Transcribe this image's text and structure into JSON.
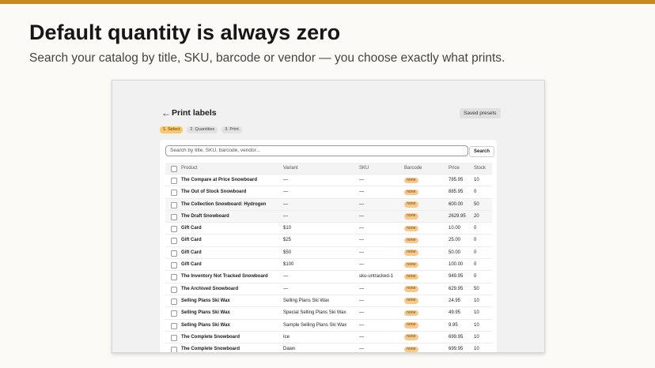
{
  "headline": "Default quantity is always zero",
  "subline": "Search your catalog by title, SKU, barcode or vendor — you choose exactly what prints.",
  "app": {
    "back_icon": "←",
    "title": "Print labels",
    "saved_presets": "Saved presets",
    "steps": [
      "1. Select",
      "2. Quantities",
      "3. Print"
    ],
    "search": {
      "placeholder": "Search by title, SKU, barcode, vendor...",
      "button": "Search"
    },
    "columns": [
      "Product",
      "Variant",
      "SKU",
      "Barcode",
      "Price",
      "Stock"
    ],
    "rows": [
      {
        "product": "The Compare at Price Snowboard",
        "variant": "—",
        "sku": "—",
        "barcode": "none",
        "price": "785.95",
        "stock": "10"
      },
      {
        "product": "The Out of Stock Snowboard",
        "variant": "—",
        "sku": "—",
        "barcode": "none",
        "price": "885.95",
        "stock": "0"
      },
      {
        "product": "The Collection Snowboard: Hydrogen",
        "variant": "—",
        "sku": "—",
        "barcode": "none",
        "price": "600.00",
        "stock": "50"
      },
      {
        "product": "The Draft Snowboard",
        "variant": "—",
        "sku": "—",
        "barcode": "none",
        "price": "2629.95",
        "stock": "20"
      },
      {
        "product": "Gift Card",
        "variant": "$10",
        "sku": "—",
        "barcode": "none",
        "price": "10.00",
        "stock": "0"
      },
      {
        "product": "Gift Card",
        "variant": "$25",
        "sku": "—",
        "barcode": "none",
        "price": "25.00",
        "stock": "0"
      },
      {
        "product": "Gift Card",
        "variant": "$50",
        "sku": "—",
        "barcode": "none",
        "price": "50.00",
        "stock": "0"
      },
      {
        "product": "Gift Card",
        "variant": "$100",
        "sku": "—",
        "barcode": "none",
        "price": "100.00",
        "stock": "0"
      },
      {
        "product": "The Inventory Not Tracked Snowboard",
        "variant": "—",
        "sku": "sku-untracked-1",
        "barcode": "none",
        "price": "949.95",
        "stock": "0"
      },
      {
        "product": "The Archived Snowboard",
        "variant": "—",
        "sku": "—",
        "barcode": "none",
        "price": "629.95",
        "stock": "50"
      },
      {
        "product": "Selling Plans Ski Wax",
        "variant": "Selling Plans Ski Wax",
        "sku": "—",
        "barcode": "none",
        "price": "24.95",
        "stock": "10"
      },
      {
        "product": "Selling Plans Ski Wax",
        "variant": "Special Selling Plans Ski Wax",
        "sku": "—",
        "barcode": "none",
        "price": "49.95",
        "stock": "10"
      },
      {
        "product": "Selling Plans Ski Wax",
        "variant": "Sample Selling Plans Ski Wax",
        "sku": "—",
        "barcode": "none",
        "price": "9.95",
        "stock": "10"
      },
      {
        "product": "The Complete Snowboard",
        "variant": "Ice",
        "sku": "—",
        "barcode": "none",
        "price": "699.95",
        "stock": "10"
      },
      {
        "product": "The Complete Snowboard",
        "variant": "Dawn",
        "sku": "—",
        "barcode": "none",
        "price": "699.95",
        "stock": "10"
      }
    ]
  }
}
